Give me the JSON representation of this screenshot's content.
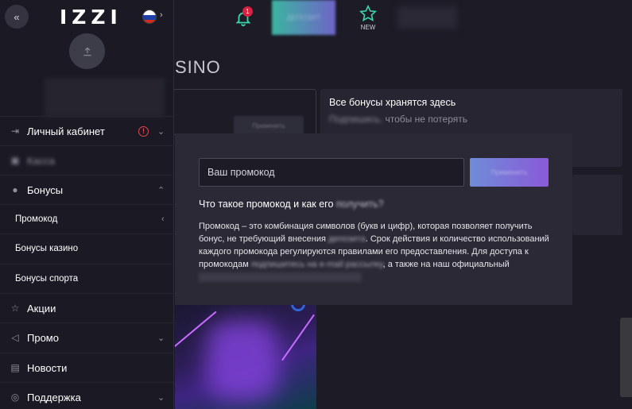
{
  "header": {
    "notification_count": "1",
    "deposit_label": "ДЕПОЗИТ",
    "new_label": "NEW"
  },
  "page": {
    "title": "SINO"
  },
  "cards": {
    "left_button": "Применить",
    "right_title": "Все бонусы хранятся здесь",
    "right_sub_link": "Подпишись,",
    "right_sub_rest": " чтобы не потерять"
  },
  "modal": {
    "input_placeholder": "Ваш промокод",
    "apply_label": "Применить",
    "question_main": "Что такое промокод и как его ",
    "question_blur": "получить?",
    "body_1": "Промокод – это комбинация символов (букв и цифр), которая позволяет получить бонус, не требующий внесения ",
    "body_blur_1": "депозита",
    "body_2": ". Срок действия и количество использований каждого промокода регулируются правилами его предоставления. Для доступа к промокодам ",
    "body_blur_2": "подпишитесь на е-mail рассылку",
    "body_3": ", а также на наш официальный "
  },
  "sidebar": {
    "collapse_icon": "«",
    "logo": "IZZI",
    "items": [
      {
        "label": "Личный кабинет"
      },
      {
        "label": "Касса"
      },
      {
        "label": "Бонусы"
      },
      {
        "label": "Промокод"
      },
      {
        "label": "Бонусы казино"
      },
      {
        "label": "Бонусы спорта"
      },
      {
        "label": "Акции"
      },
      {
        "label": "Промо"
      },
      {
        "label": "Новости"
      },
      {
        "label": "Поддержка"
      }
    ]
  },
  "colors": {
    "background": "#1c1b26",
    "sidebar": "#1b1a24",
    "modal": "#2a2935",
    "accent_gradient_start": "#6f8bd8",
    "accent_gradient_end": "#8a5ad8",
    "warning": "#e5484d"
  }
}
